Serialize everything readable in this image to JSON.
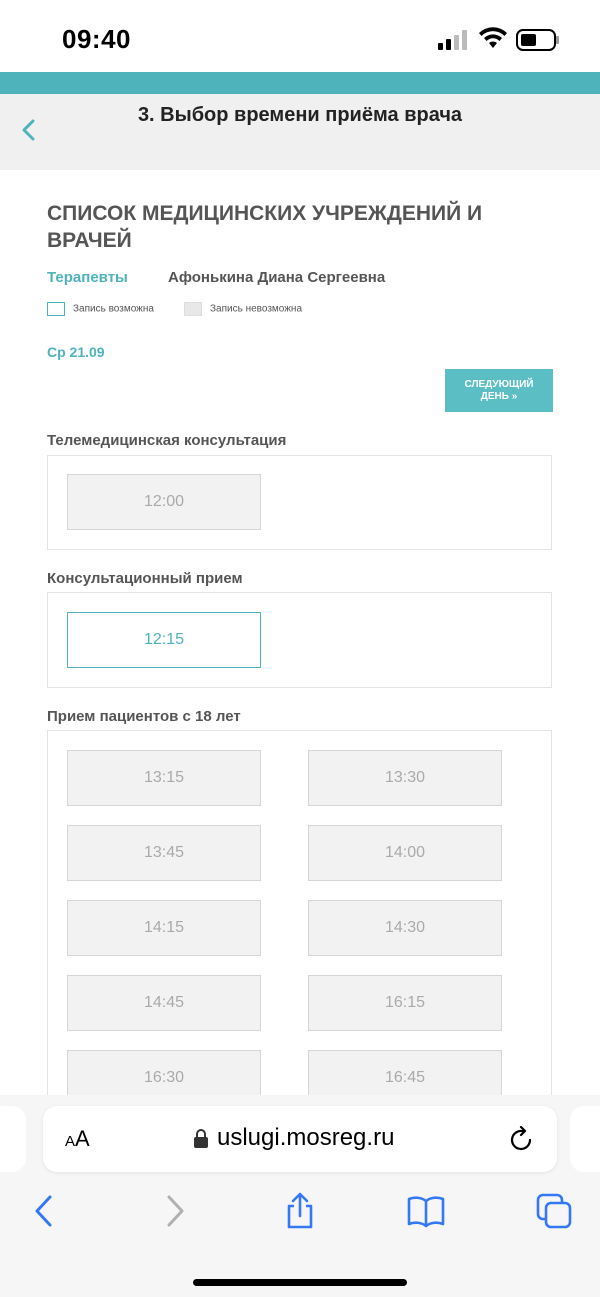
{
  "status_bar": {
    "time": "09:40"
  },
  "header": {
    "title": "3. Выбор времени приёма врача"
  },
  "main": {
    "section_title": "СПИСОК МЕДИЦИНСКИХ УЧРЕЖДЕНИЙ И ВРАЧЕЙ",
    "specialty": "Терапевты",
    "doctor": "Афонькина Диана Сергеевна",
    "legend": {
      "available": "Запись возможна",
      "unavailable": "Запись невозможна"
    },
    "date": "Ср 21.09",
    "next_day_label": "СЛЕДУЮЩИЙ ДЕНЬ »",
    "groups": [
      {
        "title": "Телемедицинская консультация",
        "slots": [
          {
            "time": "12:00",
            "available": false
          }
        ]
      },
      {
        "title": "Консультационный прием",
        "slots": [
          {
            "time": "12:15",
            "available": true
          }
        ]
      },
      {
        "title": "Прием пациентов с 18 лет",
        "slots": [
          {
            "time": "13:15",
            "available": false
          },
          {
            "time": "13:30",
            "available": false
          },
          {
            "time": "13:45",
            "available": false
          },
          {
            "time": "14:00",
            "available": false
          },
          {
            "time": "14:15",
            "available": false
          },
          {
            "time": "14:30",
            "available": false
          },
          {
            "time": "14:45",
            "available": false
          },
          {
            "time": "16:15",
            "available": false
          },
          {
            "time": "16:30",
            "available": false
          },
          {
            "time": "16:45",
            "available": false
          }
        ]
      }
    ]
  },
  "browser": {
    "text_size_label_small": "A",
    "text_size_label_large": "A",
    "url": "uslugi.mosreg.ru"
  },
  "colors": {
    "accent": "#4fb3bc",
    "button": "#5bbec4"
  }
}
